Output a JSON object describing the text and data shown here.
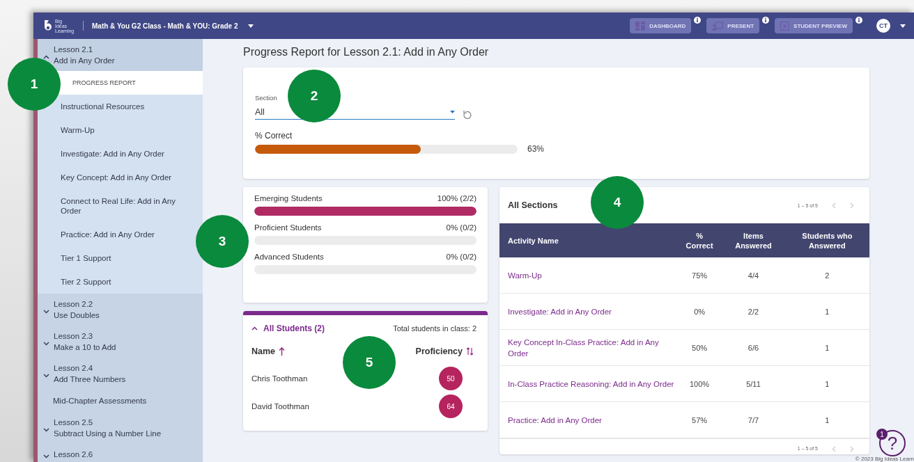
{
  "header": {
    "logo_text": "Big Ideas Learning",
    "class_title": "Math & You G2 Class - Math & YOU: Grade 2",
    "buttons": [
      {
        "label": "DASHBOARD",
        "kind": "dashboard",
        "disabled": true
      },
      {
        "label": "PRESENT",
        "kind": "present",
        "disabled": true
      },
      {
        "label": "STUDENT PREVIEW",
        "kind": "preview",
        "disabled": true
      }
    ],
    "avatar": "CT"
  },
  "sidebar": {
    "items": [
      {
        "kind": "lesson",
        "title": "Lesson 2.1",
        "subtitle": "Add in Any Order",
        "expanded": true,
        "children": [
          {
            "label": "PROGRESS REPORT",
            "selected": true
          },
          {
            "label": "Instructional Resources",
            "selected": false
          },
          {
            "label": "Warm-Up",
            "selected": false
          },
          {
            "label": "Investigate: Add in Any Order",
            "selected": false
          },
          {
            "label": "Key Concept: Add in Any Order",
            "selected": false
          },
          {
            "label": "Connect to Real Life: Add in Any Order",
            "selected": false
          },
          {
            "label": "Practice: Add in Any Order",
            "selected": false
          },
          {
            "label": "Tier 1 Support",
            "selected": false
          },
          {
            "label": "Tier 2 Support",
            "selected": false
          }
        ]
      },
      {
        "kind": "lesson",
        "title": "Lesson 2.2",
        "subtitle": "Use Doubles",
        "expanded": false
      },
      {
        "kind": "lesson",
        "title": "Lesson 2.3",
        "subtitle": "Make a 10 to Add",
        "expanded": false
      },
      {
        "kind": "lesson",
        "title": "Lesson 2.4",
        "subtitle": "Add Three Numbers",
        "expanded": false
      },
      {
        "kind": "item",
        "title": "Mid-Chapter Assessments"
      },
      {
        "kind": "lesson",
        "title": "Lesson 2.5",
        "subtitle": "Subtract Using a Number Line",
        "expanded": false
      },
      {
        "kind": "lesson",
        "title": "Lesson 2.6",
        "expanded": false
      }
    ]
  },
  "page_title": "Progress Report for Lesson 2.1: Add in Any Order",
  "filter": {
    "label": "Section",
    "value": "All",
    "correct_label": "% Correct",
    "level": 0.63,
    "reading": "63%"
  },
  "proficiency": [
    {
      "name": "Emerging Students",
      "reading": "100% (2/2)",
      "level": 1
    },
    {
      "name": "Proficient Students",
      "reading": "0% (0/2)",
      "level": 0
    },
    {
      "name": "Advanced Students",
      "reading": "0% (0/2)",
      "level": 0
    }
  ],
  "students": {
    "title": "All Students (2)",
    "expanded": true,
    "total": "Total students in class: 2",
    "columns": [
      "Name",
      "Proficiency"
    ],
    "rows": [
      {
        "name": "Chris Toothman",
        "score": "50"
      },
      {
        "name": "David Toothman",
        "score": "64"
      }
    ]
  },
  "sections": {
    "title": "All Sections",
    "range": "1 – 5 of 5",
    "columns": [
      "Activity Name",
      "% Correct",
      "Items Answered",
      "Students who Answered"
    ],
    "rows": [
      {
        "activity": "Warm-Up",
        "correct": "75%",
        "items": "4/4",
        "students": "2"
      },
      {
        "activity": "Investigate: Add in Any Order",
        "correct": "0%",
        "items": "2/2",
        "students": "1"
      },
      {
        "activity": "Key Concept In-Class Practice: Add in Any Order",
        "correct": "50%",
        "items": "6/6",
        "students": "1"
      },
      {
        "activity": "In-Class Practice Reasoning: Add in Any Order",
        "correct": "100%",
        "items": "5/11",
        "students": "1"
      },
      {
        "activity": "Practice: Add in Any Order",
        "correct": "57%",
        "items": "7/7",
        "students": "1"
      }
    ],
    "footer_range": "1 – 5 of 5"
  },
  "help": {
    "glyph": "?",
    "badge": "1"
  },
  "copyright": "© 2023 Big Ideas Learn",
  "callouts": [
    "1",
    "2",
    "3",
    "4",
    "5"
  ]
}
